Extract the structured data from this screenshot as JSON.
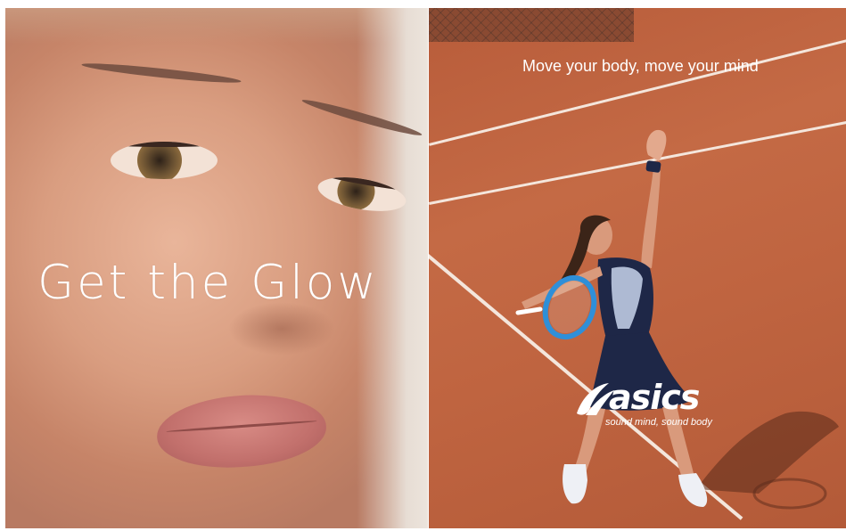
{
  "left_panel": {
    "headline": "Get the Glow"
  },
  "right_panel": {
    "tagline": "Move your body, move your mind",
    "brand": {
      "logo_text": "asics",
      "slogan": "sound mind, sound body"
    }
  },
  "colors": {
    "clay": "#c46a45",
    "skin": "#e3a98d",
    "dress": "#1e2747",
    "racket": "#2f8fd8",
    "text": "#ffffff"
  }
}
